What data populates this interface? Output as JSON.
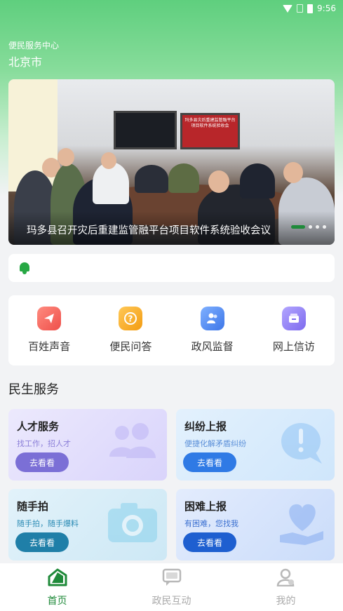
{
  "status": {
    "time": "9:56"
  },
  "location": {
    "subtitle": "便民服务中心",
    "city": "北京市"
  },
  "banner": {
    "title": "玛多县召开灾后重建监管融平台项目软件系统验收会议",
    "screen_text": "玛多县灾后重建监管融平台项目软件系统验收会",
    "slide_count": 4,
    "active_slide": 1
  },
  "notice": {
    "text": ""
  },
  "quick_actions": [
    {
      "label": "百姓声音",
      "icon": "paper-plane-icon",
      "color": "#f0625a"
    },
    {
      "label": "便民问答",
      "icon": "question-bubble-icon",
      "color": "#f5a623"
    },
    {
      "label": "政风监督",
      "icon": "people-icon",
      "color": "#4a86f0"
    },
    {
      "label": "网上信访",
      "icon": "mailbox-icon",
      "color": "#8c7cf0"
    }
  ],
  "section": {
    "title": "民生服务"
  },
  "service_cards": [
    {
      "title": "人才服务",
      "subtitle": "找工作，招人才",
      "button": "去看看",
      "icon": "users-icon",
      "accent": "#7b6fd6"
    },
    {
      "title": "纠纷上报",
      "subtitle": "便捷化解矛盾纠纷",
      "button": "去看看",
      "icon": "alert-bubble-icon",
      "accent": "#2f7ae5"
    },
    {
      "title": "随手拍",
      "subtitle": "随手拍，随手爆料",
      "button": "去看看",
      "icon": "camera-icon",
      "accent": "#1f7fa8"
    },
    {
      "title": "困难上报",
      "subtitle": "有困难，您找我",
      "button": "去看看",
      "icon": "heart-hand-icon",
      "accent": "#1e5fd0"
    }
  ],
  "tabs": [
    {
      "label": "首页",
      "icon": "home-icon",
      "active": true
    },
    {
      "label": "政民互动",
      "icon": "chat-icon",
      "active": false
    },
    {
      "label": "我的",
      "icon": "profile-icon",
      "active": false
    }
  ],
  "colors": {
    "primary": "#1f8a3a",
    "inactive_tab": "#aaaaaa"
  }
}
